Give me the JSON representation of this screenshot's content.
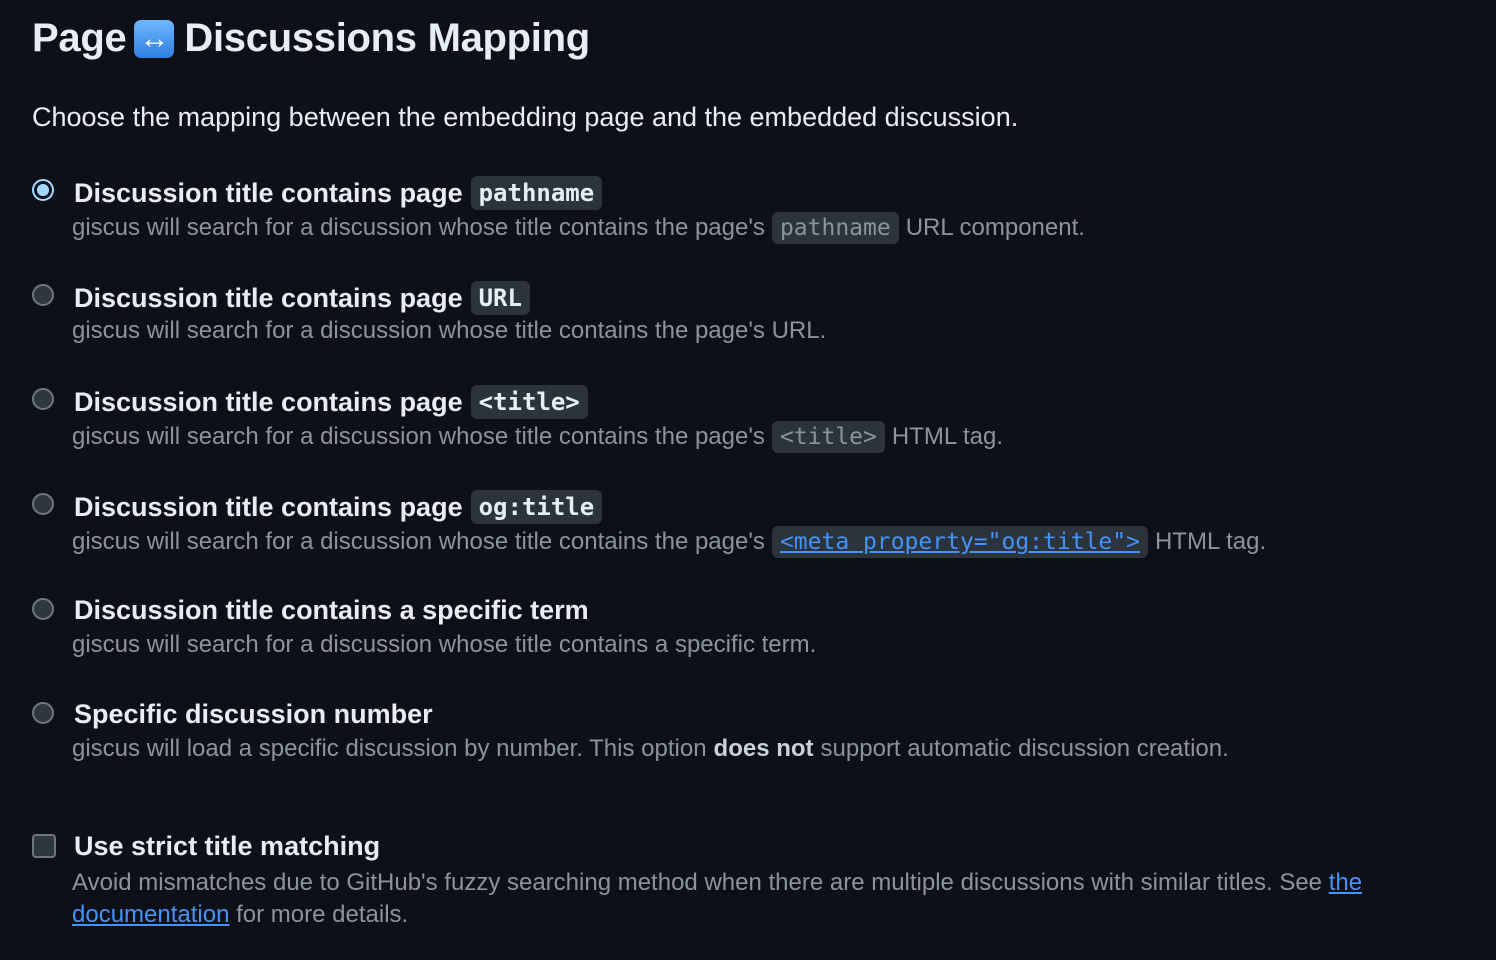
{
  "header": {
    "title_left": "Page",
    "emoji": "↔",
    "title_right": "Discussions Mapping"
  },
  "intro": "Choose the mapping between the embedding page and the embedded discussion.",
  "options": [
    {
      "label": "Discussion title contains page",
      "code": "pathname",
      "desc_before": "giscus will search for a discussion whose title contains the page's",
      "desc_code": "pathname",
      "desc_after": "URL component.",
      "selected": true
    },
    {
      "label": "Discussion title contains page",
      "code": "URL",
      "desc_before": "giscus will search for a discussion whose title contains the page's URL.",
      "selected": false
    },
    {
      "label": "Discussion title contains page",
      "code": "<title>",
      "desc_before": "giscus will search for a discussion whose title contains the page's",
      "desc_code": "<title>",
      "desc_after": "HTML tag.",
      "selected": false
    },
    {
      "label": "Discussion title contains page",
      "code": "og:title",
      "desc_before": "giscus will search for a discussion whose title contains the page's",
      "desc_link": "<meta property=\"og:title\">",
      "desc_after": "HTML tag.",
      "selected": false
    },
    {
      "label": "Discussion title contains a specific term",
      "desc_before": "giscus will search for a discussion whose title contains a specific term.",
      "selected": false
    },
    {
      "label": "Specific discussion number",
      "desc_before": "giscus will load a specific discussion by number. This option",
      "desc_strong": "does not",
      "desc_after": "support automatic discussion creation.",
      "selected": false
    }
  ],
  "strict": {
    "label": "Use strict title matching",
    "desc_before": "Avoid mismatches due to GitHub's fuzzy searching method when there are multiple discussions with similar titles. See ",
    "link": "the documentation",
    "desc_after": " for more details.",
    "checked": false
  },
  "colors": {
    "background": "#0d1117",
    "text": "#e6edf3",
    "muted": "#8b949e",
    "link": "#4493f8",
    "radio_selected": "#a5d6ff"
  }
}
